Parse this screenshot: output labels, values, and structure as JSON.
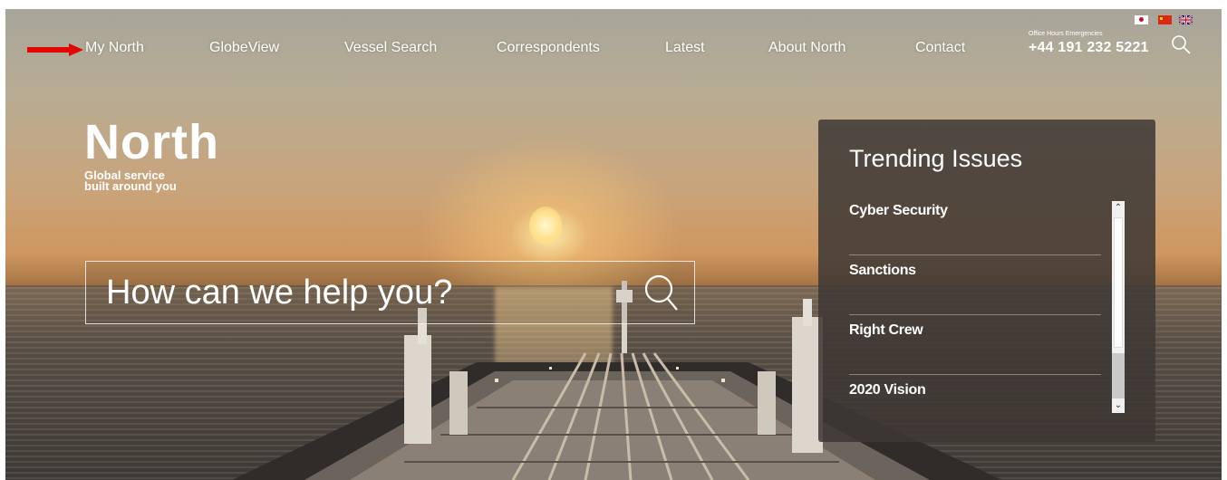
{
  "nav": {
    "items": [
      {
        "label": "My North"
      },
      {
        "label": "GlobeView"
      },
      {
        "label": "Vessel Search"
      },
      {
        "label": "Correspondents"
      },
      {
        "label": "Latest"
      },
      {
        "label": "About North"
      },
      {
        "label": "Contact"
      }
    ],
    "office_hours_label": "Office Hours Emergencies",
    "phone": "+44 191 232 5221",
    "search_icon": "search-icon",
    "arrow_icon": "arrow-right-icon",
    "arrow_color": "#e10600"
  },
  "languages": [
    {
      "code": "jp",
      "icon": "japan-flag-icon"
    },
    {
      "code": "cn",
      "icon": "china-flag-icon"
    },
    {
      "code": "uk",
      "icon": "uk-flag-icon"
    }
  ],
  "logo": {
    "wordmark": "North",
    "tagline_line1": "Global service",
    "tagline_line2": "built around you"
  },
  "hero": {
    "search_placeholder": "How can we help you?",
    "search_icon": "search-icon"
  },
  "trending": {
    "title": "Trending Issues",
    "items": [
      {
        "label": "Cyber Security"
      },
      {
        "label": "Sanctions"
      },
      {
        "label": "Right Crew"
      },
      {
        "label": "2020 Vision"
      }
    ],
    "scroll_up_icon": "chevron-up-icon",
    "scroll_down_icon": "chevron-down-icon"
  }
}
